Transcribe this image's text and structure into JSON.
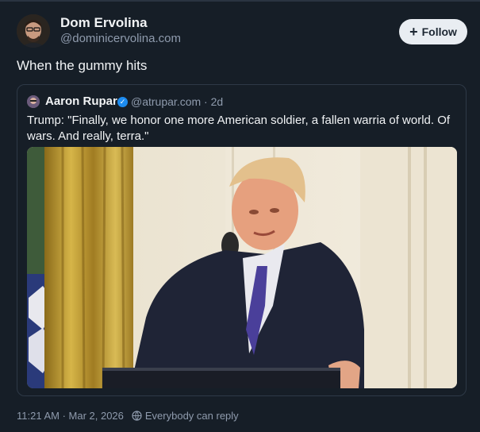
{
  "post": {
    "author_name": "Dom Ervolina",
    "author_handle": "@dominicervolina.com",
    "follow_label": "Follow",
    "text": "When the gummy hits",
    "timestamp": "11:21 AM · Mar 2, 2026",
    "reply_setting": "Everybody can reply"
  },
  "quote": {
    "author_name": "Aaron Rupar",
    "handle_time": "@atrupar.com · 2d",
    "text": "Trump: \"Finally, we honor one more American soldier, a fallen warria of world. Of wars. And really, terra.\""
  },
  "icons": {
    "follow": "plus-icon",
    "verified": "verified-check-icon",
    "reply_setting": "globe-icon"
  },
  "colors": {
    "background": "#161e27",
    "accent_verified": "#1d8cf0",
    "muted_text": "#8f9bad",
    "follow_button": "#e9edf2"
  }
}
